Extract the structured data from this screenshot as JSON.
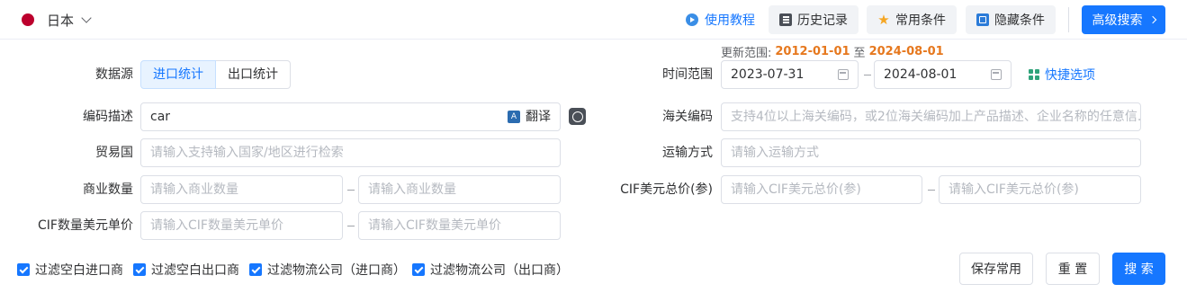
{
  "topbar": {
    "country": "日本",
    "tutorial": "使用教程",
    "history": "历史记录",
    "favorites": "常用条件",
    "hide": "隐藏条件",
    "advanced": "高级搜索"
  },
  "range_note": {
    "label": "更新范围:",
    "start": "2012-01-01",
    "sep": "至",
    "end": "2024-08-01"
  },
  "form": {
    "data_source": {
      "label": "数据源",
      "options": [
        "进口统计",
        "出口统计"
      ],
      "selected": "进口统计"
    },
    "time_range": {
      "label": "时间范围",
      "start": "2023-07-31",
      "end": "2024-08-01",
      "quick": "快捷选项"
    },
    "code_desc": {
      "label": "编码描述",
      "value": "car",
      "translate": "翻译"
    },
    "hs_code": {
      "label": "海关编码",
      "placeholder": "支持4位以上海关编码，或2位海关编码加上产品描述、企业名称的任意信..."
    },
    "trade_country": {
      "label": "贸易国",
      "placeholder": "请输入支持输入国家/地区进行检索"
    },
    "transport": {
      "label": "运输方式",
      "placeholder": "请输入运输方式"
    },
    "quantity": {
      "label": "商业数量",
      "placeholder_min": "请输入商业数量",
      "placeholder_max": "请输入商业数量"
    },
    "cif_total": {
      "label": "CIF美元总价(参)",
      "placeholder_min": "请输入CIF美元总价(参)",
      "placeholder_max": "请输入CIF美元总价(参)"
    },
    "cif_unit": {
      "label": "CIF数量美元单价",
      "placeholder_min": "请输入CIF数量美元单价",
      "placeholder_max": "请输入CIF数量美元单价"
    }
  },
  "filters": [
    {
      "label": "过滤空白进口商",
      "checked": true
    },
    {
      "label": "过滤空白出口商",
      "checked": true
    },
    {
      "label": "过滤物流公司（进口商）",
      "checked": true
    },
    {
      "label": "过滤物流公司（出口商）",
      "checked": true
    }
  ],
  "actions": {
    "save": "保存常用",
    "reset": "重 置",
    "search": "搜 索"
  },
  "colors": {
    "primary": "#1677ff",
    "date_highlight": "#e6781e",
    "flag": "#bc002d"
  }
}
